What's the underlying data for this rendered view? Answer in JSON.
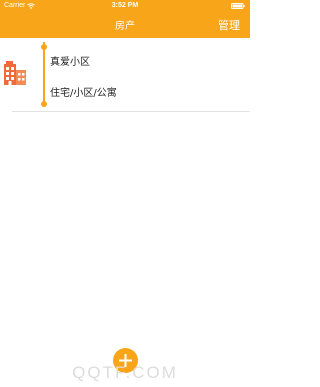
{
  "status_bar": {
    "carrier": "Carrier",
    "time": "3:52 PM",
    "wifi_icon": "wifi-icon",
    "battery_icon": "battery-icon"
  },
  "nav": {
    "title": "房产",
    "right_button": "管理"
  },
  "list": {
    "items": [
      {
        "icon": "building-icon",
        "name": "真爱小区",
        "type": "住宅/小区/公寓"
      }
    ]
  },
  "fab": {
    "icon": "plus-icon"
  },
  "watermark": "QQTF.COM",
  "colors": {
    "accent": "#f9a51a",
    "building_icon": "#ef6a3a"
  }
}
